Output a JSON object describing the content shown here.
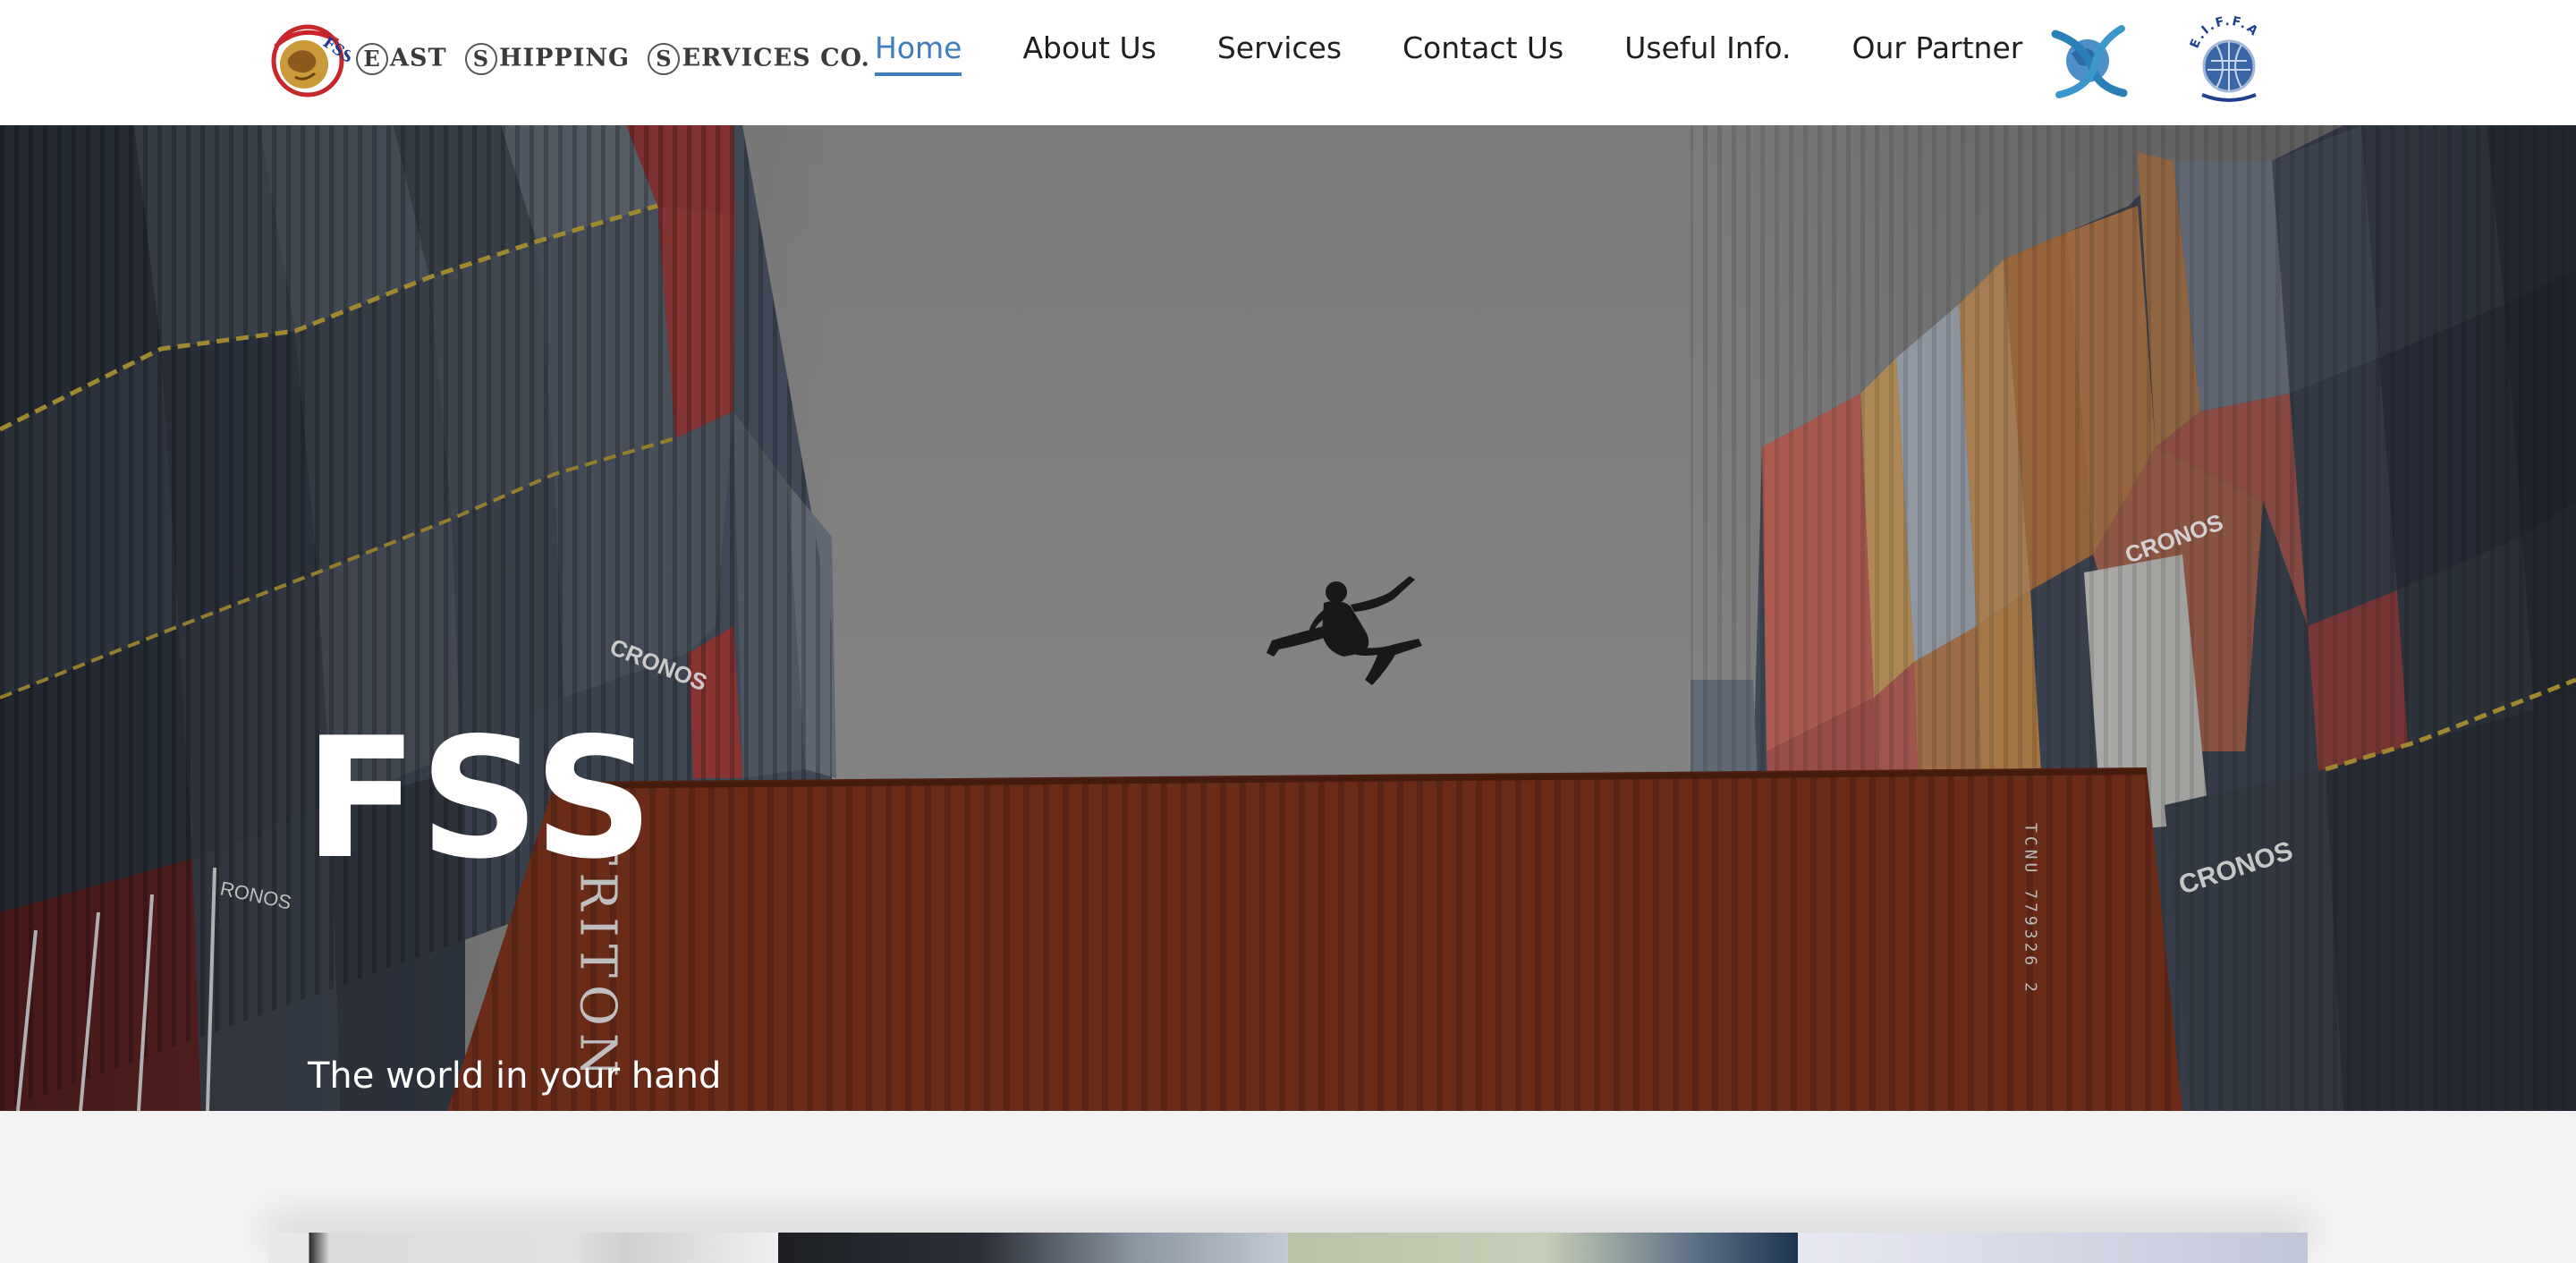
{
  "header": {
    "logo": {
      "mark_text": "FSS",
      "company_name": "EAST SHIPPING SERVICES CO."
    },
    "nav": [
      {
        "label": "Home",
        "active": true
      },
      {
        "label": "About Us",
        "active": false
      },
      {
        "label": "Services",
        "active": false
      },
      {
        "label": "Contact Us",
        "active": false
      },
      {
        "label": "Useful Info.",
        "active": false
      },
      {
        "label": "Our Partner",
        "active": false
      }
    ],
    "partners": [
      {
        "name": "globe-ribbon-partner-logo"
      },
      {
        "name": "eifa-partner-logo",
        "text": "E.I.F.F.A"
      }
    ]
  },
  "hero": {
    "title": "FSS",
    "subtitle": "The world in your hand"
  },
  "colors": {
    "accent": "#3f7dbf",
    "text": "#1f1f1f",
    "header_bg": "#ffffff",
    "page_bg": "#f2f2f2",
    "hero_text": "#ffffff"
  }
}
